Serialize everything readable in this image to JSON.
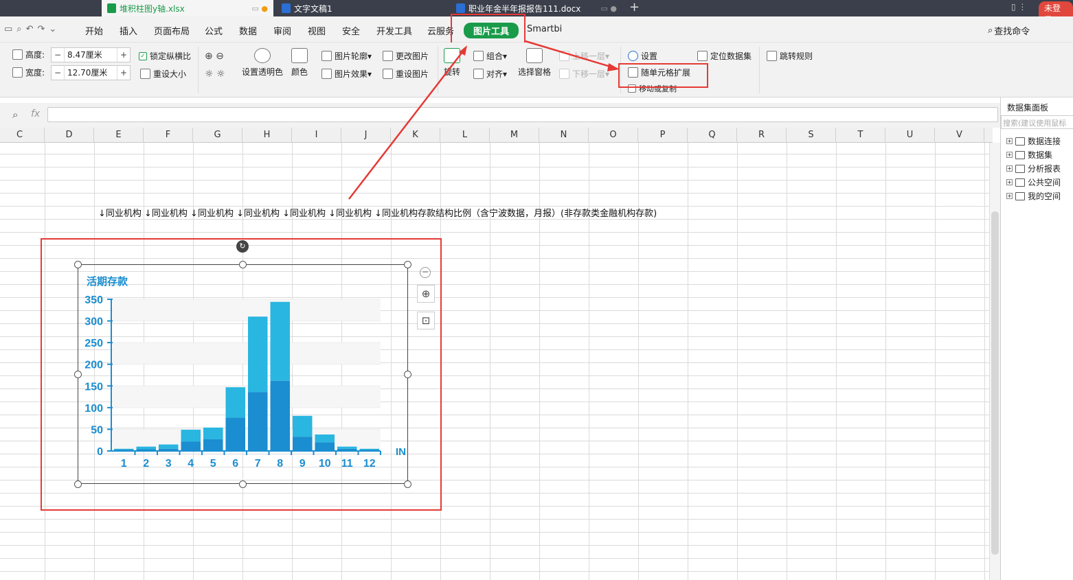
{
  "tabs": [
    {
      "label": "堆积柱图y轴.xlsx",
      "active": true,
      "icon": "spreadsheet-icon",
      "color": "#1a9b4a"
    },
    {
      "label": "文字文稿1",
      "active": false,
      "icon": "document-icon",
      "color": "#2b6fd6"
    },
    {
      "label": "职业年金半年报报告111.docx",
      "active": false,
      "icon": "document-icon",
      "color": "#2b6fd6"
    }
  ],
  "login_label": "未登录",
  "menu": [
    "开始",
    "插入",
    "页面布局",
    "公式",
    "数据",
    "审阅",
    "视图",
    "安全",
    "开发工具",
    "云服务",
    "图片工具",
    "Smartbi"
  ],
  "active_menu": "图片工具",
  "search_cmd": "查找命令",
  "toolbar": {
    "height_label": "高度:",
    "height_value": "8.47厘米",
    "width_label": "宽度:",
    "width_value": "12.70厘米",
    "lock_ratio": "锁定纵横比",
    "resize": "重设大小",
    "transparency": "设置透明色",
    "color": "颜色",
    "outline": "图片轮廓",
    "effects": "图片效果",
    "change_pic": "更改图片",
    "reset_pic": "重设图片",
    "rotate": "旋转",
    "group": "组合",
    "align": "对齐",
    "selection_pane": "选择窗格",
    "bring_forward": "上移一层",
    "send_backward": "下移一层",
    "settings": "设置",
    "cell_expand": "随单元格扩展",
    "move_copy": "移动或复制",
    "locate_dataset": "定位数据集",
    "jump_rule": "跳转规则"
  },
  "formula_fx": "fx",
  "columns": [
    "C",
    "D",
    "E",
    "F",
    "G",
    "H",
    "I",
    "J",
    "K",
    "L",
    "M",
    "N",
    "O",
    "P",
    "Q",
    "R",
    "S",
    "T",
    "U",
    "V"
  ],
  "cell_text": "↓同业机构 ↓同业机构 ↓同业机构 ↓同业机构 ↓同业机构 ↓同业机构 ↓同业机构存款结构比例（含宁波数据，月报）(非存款类金融机构存款)",
  "panel": {
    "title": "数据集面板",
    "search_placeholder": "搜索(建议使用鼠标",
    "items": [
      "数据连接",
      "数据集",
      "分析报表",
      "公共空间",
      "我的空间"
    ]
  },
  "colors": {
    "accent_green": "#1a9b4a",
    "highlight_red": "#e53935",
    "bar_dark": "#1a8ed0",
    "bar_light": "#29b6e0"
  },
  "chart_data": {
    "type": "bar",
    "stacked": true,
    "title": "活期存款",
    "categories": [
      "1",
      "2",
      "3",
      "4",
      "5",
      "6",
      "7",
      "8",
      "9",
      "10",
      "11",
      "12"
    ],
    "series": [
      {
        "values": [
          3,
          4,
          5,
          22,
          27,
          77,
          136,
          162,
          33,
          20,
          5,
          3
        ]
      },
      {
        "values": [
          2,
          6,
          10,
          27,
          27,
          70,
          174,
          182,
          48,
          18,
          5,
          2
        ]
      }
    ],
    "x_label_partial": "IN",
    "ylim": [
      0,
      350
    ],
    "yticks": [
      0,
      50,
      100,
      150,
      200,
      250,
      300,
      350
    ],
    "grid": true
  }
}
